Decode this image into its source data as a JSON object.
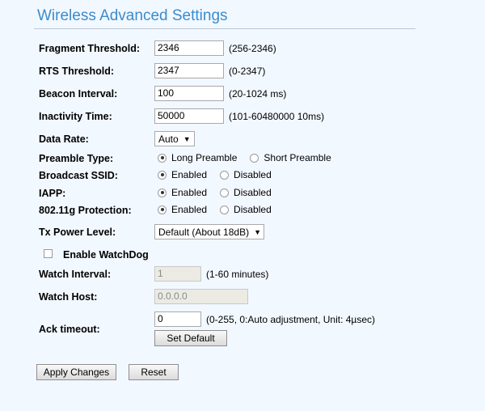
{
  "page": {
    "title": "Wireless Advanced Settings"
  },
  "fields": {
    "fragment_threshold": {
      "label": "Fragment Threshold:",
      "value": "2346",
      "hint": "(256-2346)"
    },
    "rts_threshold": {
      "label": "RTS Threshold:",
      "value": "2347",
      "hint": "(0-2347)"
    },
    "beacon_interval": {
      "label": "Beacon Interval:",
      "value": "100",
      "hint": "(20-1024 ms)"
    },
    "inactivity_time": {
      "label": "Inactivity Time:",
      "value": "50000",
      "hint": "(101-60480000 10ms)"
    },
    "data_rate": {
      "label": "Data Rate:",
      "selected": "Auto"
    },
    "preamble_type": {
      "label": "Preamble Type:",
      "options": [
        "Long Preamble",
        "Short Preamble"
      ],
      "selected": "Long Preamble"
    },
    "broadcast_ssid": {
      "label": "Broadcast SSID:",
      "options": [
        "Enabled",
        "Disabled"
      ],
      "selected": "Enabled"
    },
    "iapp": {
      "label": "IAPP:",
      "options": [
        "Enabled",
        "Disabled"
      ],
      "selected": "Enabled"
    },
    "protection_80211g": {
      "label": "802.11g Protection:",
      "options": [
        "Enabled",
        "Disabled"
      ],
      "selected": "Enabled"
    },
    "tx_power_level": {
      "label": "Tx Power Level:",
      "selected": "Default (About 18dB)"
    },
    "enable_watchdog": {
      "label": "Enable WatchDog",
      "checked": false
    },
    "watch_interval": {
      "label": "Watch Interval:",
      "value": "1",
      "hint": "(1-60 minutes)"
    },
    "watch_host": {
      "label": "Watch Host:",
      "value": "0.0.0.0"
    },
    "ack_timeout": {
      "label": "Ack timeout:",
      "value": "0",
      "hint": "(0-255, 0:Auto adjustment, Unit: 4µsec)",
      "default_button": "Set Default"
    }
  },
  "actions": {
    "apply_label": "Apply Changes",
    "reset_label": "Reset"
  },
  "colors": {
    "background": "#f2f8ff",
    "title": "#3b8ccc"
  },
  "icons": {
    "dropdown": "chevron-down-icon"
  }
}
